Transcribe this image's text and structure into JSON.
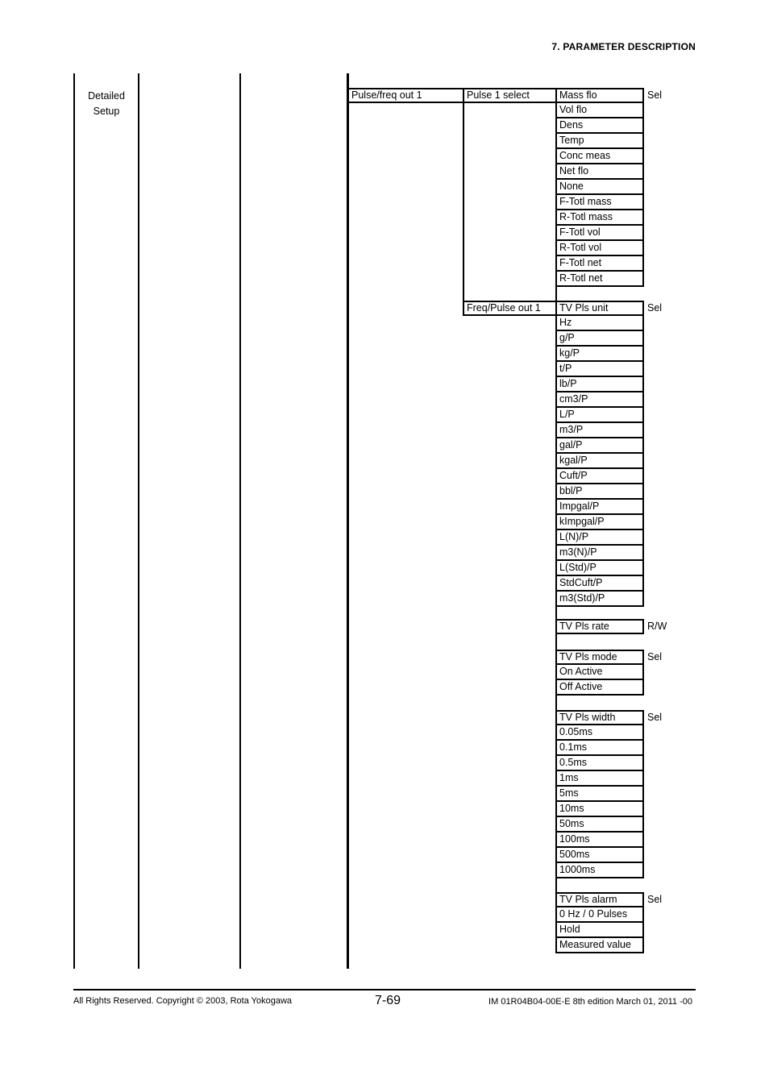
{
  "header": {
    "section_title": "7.  PARAMETER DESCRIPTION"
  },
  "tree": {
    "level1_label_line1": "Detailed",
    "level1_label_line2": "Setup",
    "level4_label": "Pulse/freq out 1",
    "groups": [
      {
        "label": "Pulse 1 select",
        "access": "Sel",
        "options": [
          "Mass flo",
          "Vol flo",
          "Dens",
          "Temp",
          "Conc meas",
          "Net flo",
          "None",
          "F-Totl mass",
          "R-Totl mass",
          "F-Totl vol",
          "R-Totl vol",
          "F-Totl net",
          "R-Totl net"
        ]
      },
      {
        "label": "Freq/Pulse out 1",
        "subgroups": [
          {
            "access": "Sel",
            "options": [
              "TV Pls unit",
              "Hz",
              "g/P",
              "kg/P",
              "t/P",
              "lb/P",
              "cm3/P",
              "L/P",
              "m3/P",
              "gal/P",
              "kgal/P",
              "Cuft/P",
              "bbl/P",
              "Impgal/P",
              "kImpgal/P",
              "L(N)/P",
              "m3(N)/P",
              "L(Std)/P",
              "StdCuft/P",
              "m3(Std)/P"
            ]
          },
          {
            "access": "R/W",
            "options": [
              "TV Pls rate"
            ]
          },
          {
            "access": "Sel",
            "options": [
              "TV Pls mode",
              "On Active",
              "Off Active"
            ]
          },
          {
            "access": "Sel",
            "options": [
              "TV Pls width",
              "0.05ms",
              "0.1ms",
              "0.5ms",
              "1ms",
              "5ms",
              "10ms",
              "50ms",
              "100ms",
              "500ms",
              "1000ms"
            ]
          },
          {
            "access": "Sel",
            "options": [
              "TV Pls alarm",
              "0 Hz / 0 Pulses",
              "Hold",
              "Measured value"
            ]
          }
        ]
      }
    ]
  },
  "footer": {
    "copyright": "All Rights Reserved. Copyright © 2003, Rota Yokogawa",
    "page_number": "7-69",
    "doc_id": "IM 01R04B04-00E-E  8th edition March 01, 2011 -00"
  }
}
